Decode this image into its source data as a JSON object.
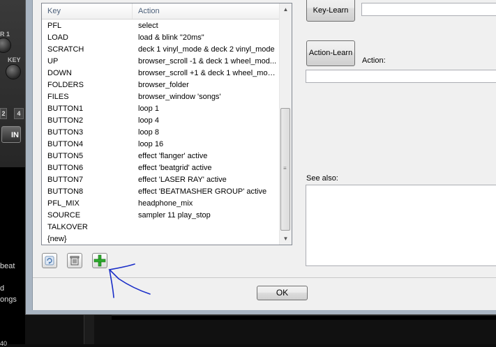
{
  "background": {
    "knob_labels": [
      "R 1",
      "KEY"
    ],
    "deck_buttons": [
      "2",
      "4"
    ],
    "in_button": "IN",
    "side_texts": [
      "beat",
      "d",
      "ongs"
    ],
    "bottom_text": "40"
  },
  "list": {
    "headers": {
      "key": "Key",
      "action": "Action"
    },
    "rows": [
      {
        "key": "PFL",
        "action": "select"
      },
      {
        "key": "LOAD",
        "action": " load & blink \"20ms\""
      },
      {
        "key": "SCRATCH",
        "action": "deck 1 vinyl_mode & deck 2 vinyl_mode"
      },
      {
        "key": "UP",
        "action": "browser_scroll -1 & deck 1 wheel_mod..."
      },
      {
        "key": "DOWN",
        "action": "browser_scroll +1 & deck 1 wheel_mod..."
      },
      {
        "key": "FOLDERS",
        "action": "browser_folder"
      },
      {
        "key": "FILES",
        "action": "browser_window 'songs'"
      },
      {
        "key": "BUTTON1",
        "action": "loop 1"
      },
      {
        "key": "BUTTON2",
        "action": "loop 4"
      },
      {
        "key": "BUTTON3",
        "action": "loop 8"
      },
      {
        "key": "BUTTON4",
        "action": "loop 16"
      },
      {
        "key": "BUTTON5",
        "action": "effect 'flanger' active"
      },
      {
        "key": "BUTTON6",
        "action": "effect 'beatgrid' active"
      },
      {
        "key": "BUTTON7",
        "action": "effect 'LASER RAY' active"
      },
      {
        "key": "BUTTON8",
        "action": "effect 'BEATMASHER GROUP' active"
      },
      {
        "key": "PFL_MIX",
        "action": "headphone_mix"
      },
      {
        "key": "SOURCE",
        "action": "sampler 11 play_stop"
      },
      {
        "key": "TALKOVER",
        "action": ""
      },
      {
        "key": "{new}",
        "action": ""
      }
    ]
  },
  "toolbar": {
    "icons": [
      "refresh-icon",
      "trash-icon",
      "add-icon"
    ]
  },
  "right": {
    "key_learn_label": "Key-Learn",
    "key_value": "",
    "action_learn_label": "Action-Learn",
    "action_label": "Action:",
    "action_value": "",
    "see_also_label": "See also:",
    "see_also_value": ""
  },
  "footer": {
    "ok_label": "OK"
  },
  "colors": {
    "annotation": "#1a2ec8",
    "add_icon": "#2eaa2e",
    "header_text": "#4c607a"
  }
}
